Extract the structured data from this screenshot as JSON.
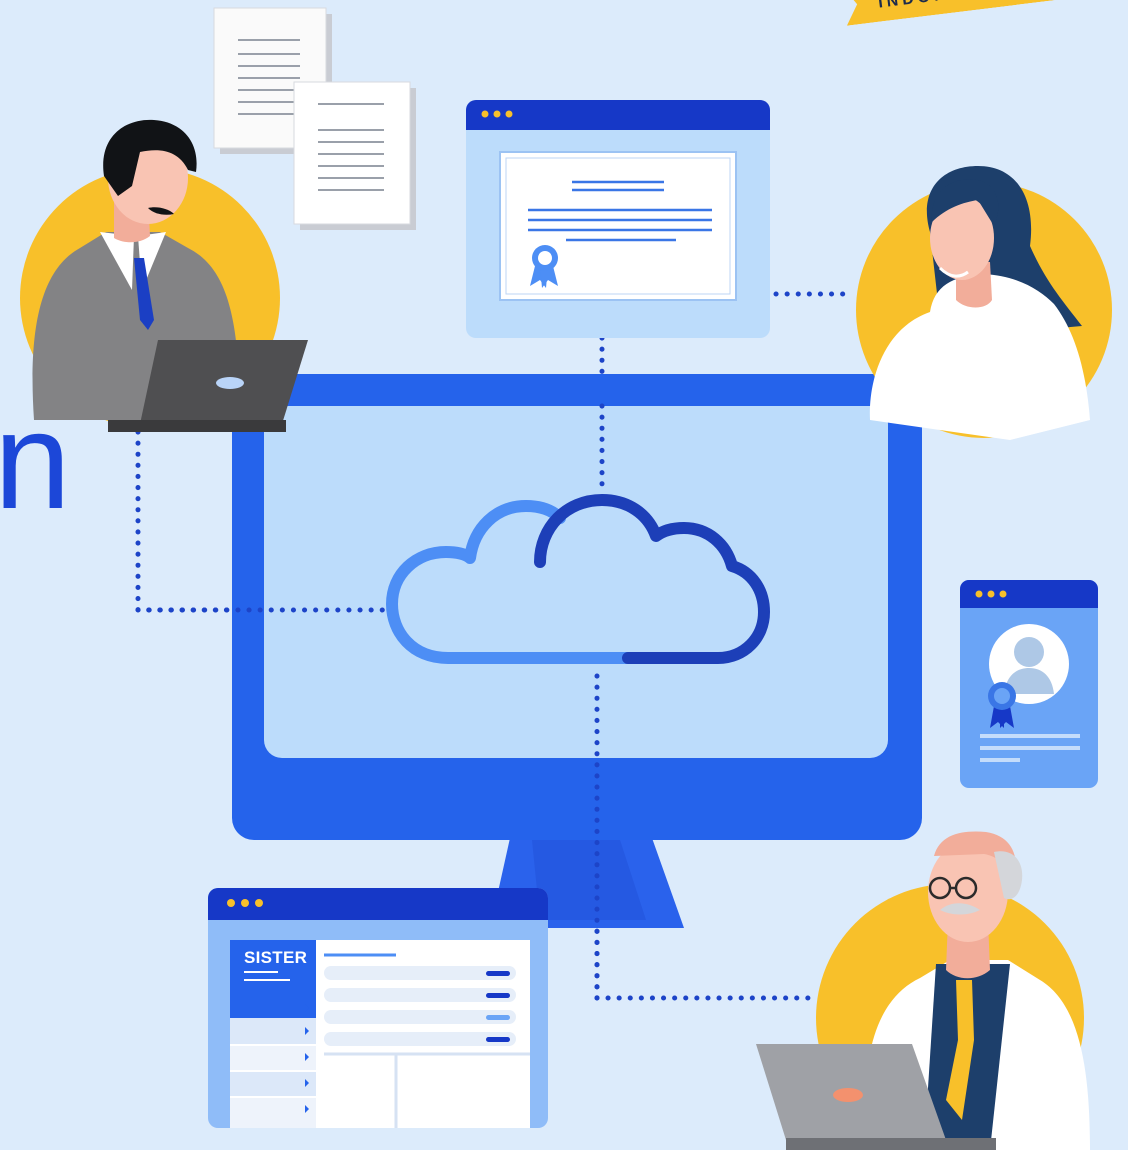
{
  "banner": {
    "text": "INDONESIA"
  },
  "headline_fragment": {
    "text": "n"
  },
  "sister_window": {
    "label": "SISTER"
  },
  "colors": {
    "background": "#dcebfb",
    "primary_blue": "#2563eb",
    "dark_blue": "#1638c7",
    "light_blue": "#bcdcfb",
    "accent_yellow": "#f8c02a",
    "dotted_line": "#1d44c8"
  },
  "icons": [
    "document-stack-icon",
    "certificate-window-icon",
    "ribbon-award-icon",
    "cloud-icon",
    "profile-card-icon",
    "laptop-icon"
  ]
}
